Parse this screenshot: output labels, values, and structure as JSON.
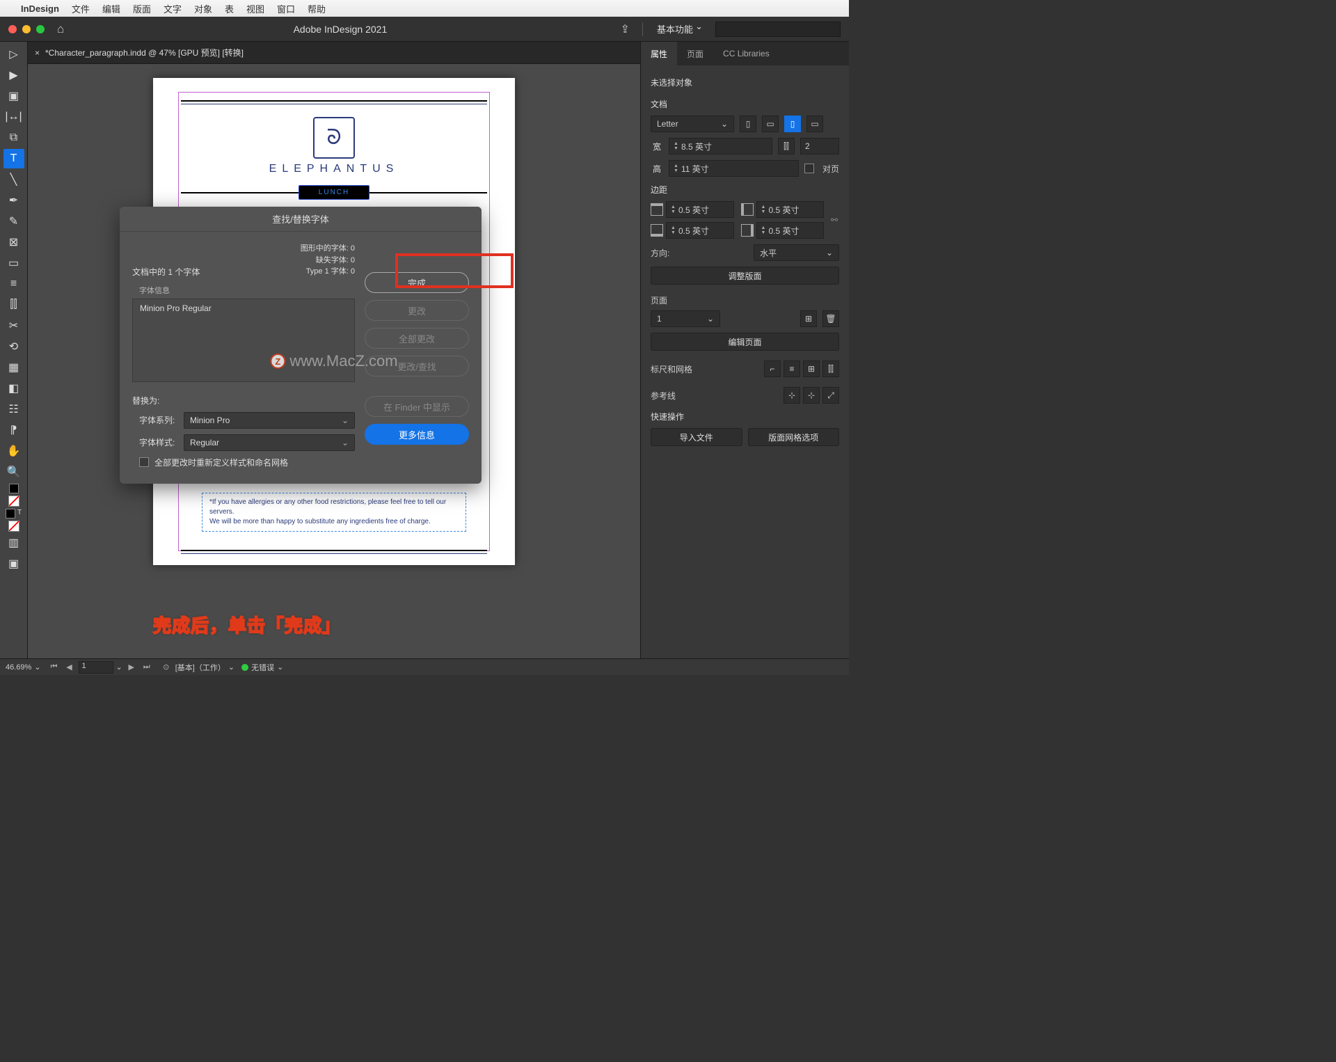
{
  "menubar": {
    "app": "InDesign",
    "items": [
      "文件",
      "编辑",
      "版面",
      "文字",
      "对象",
      "表",
      "视图",
      "窗口",
      "帮助"
    ]
  },
  "titlebar": {
    "title": "Adobe InDesign 2021",
    "workspace": "基本功能"
  },
  "doc_tab": {
    "label": "*Character_paragraph.indd @ 47% [GPU 预览] [转换]"
  },
  "page": {
    "brand": "ELEPHANTUS",
    "lunch": "LUNCH",
    "footnote1": "*If you have allergies or any other food restrictions, please feel free to tell our servers.",
    "footnote2": "We will be more than happy to substitute any ingredients free of charge."
  },
  "annotation": "完成后，单击「完成」",
  "watermark": "www.MacZ.com",
  "dialog": {
    "title": "查找/替换字体",
    "doc_fonts_label": "文档中的 1 个字体",
    "counts": {
      "graphic": "图形中的字体: 0",
      "missing": "缺失字体: 0",
      "type1": "Type 1 字体: 0"
    },
    "fontinfo_label": "字体信息",
    "font_listed": "Minion Pro Regular",
    "replace_label": "替换为:",
    "family_label": "字体系列:",
    "family_value": "Minion Pro",
    "style_label": "字体样式:",
    "style_value": "Regular",
    "checkbox_label": "全部更改时重新定义样式和命名网格",
    "buttons": {
      "done": "完成",
      "change": "更改",
      "change_all": "全部更改",
      "change_find": "更改/查找",
      "reveal": "在 Finder 中显示",
      "more": "更多信息"
    }
  },
  "panel": {
    "tabs": {
      "properties": "属性",
      "pages": "页面",
      "cc": "CC Libraries"
    },
    "no_selection": "未选择对象",
    "doc_label": "文档",
    "page_size": "Letter",
    "w_label": "宽",
    "w_val": "8.5 英寸",
    "h_label": "高",
    "h_val": "11 英寸",
    "cols_val": "2",
    "facing_label": "对页",
    "margins_label": "边距",
    "m_top": "0.5 英寸",
    "m_bottom": "0.5 英寸",
    "m_left": "0.5 英寸",
    "m_right": "0.5 英寸",
    "orient_label": "方向:",
    "orient_val": "水平",
    "adjust_layout": "调整版面",
    "pages_label": "页面",
    "page_num": "1",
    "edit_pages": "编辑页面",
    "rulers_label": "标尺和网格",
    "guides_label": "参考线",
    "quick_label": "快速操作",
    "import": "导入文件",
    "grid_opts": "版面网格选项"
  },
  "statusbar": {
    "zoom": "46.69%",
    "page": "1",
    "preflight_label": "[基本]（工作）",
    "no_errors": "无错误"
  }
}
